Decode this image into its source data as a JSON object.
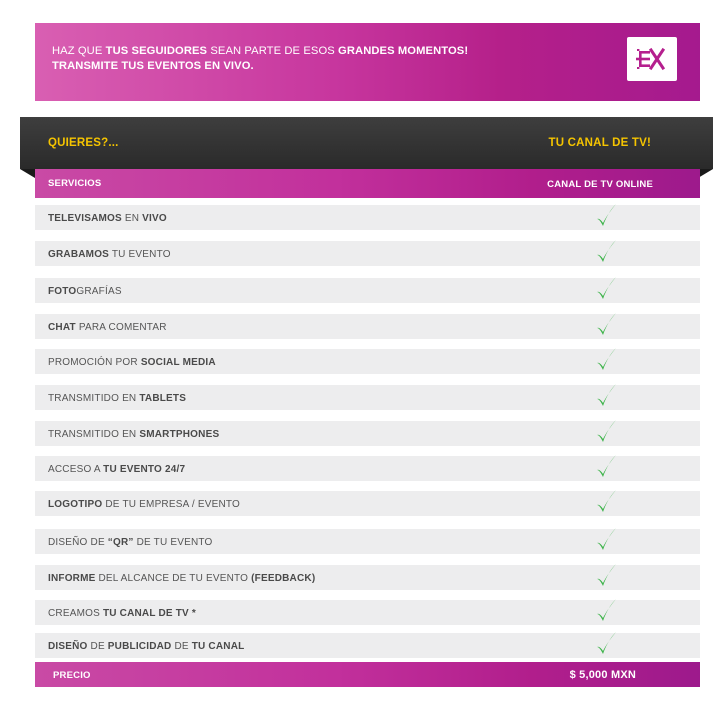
{
  "banner": {
    "line1": [
      {
        "text": "HAZ QUE ",
        "bold": false
      },
      {
        "text": "TUS SEGUIDORES",
        "bold": true
      },
      {
        "text": " SEAN PARTE DE ESOS ",
        "bold": false
      },
      {
        "text": "GRANDES MOMENTOS!",
        "bold": true
      }
    ],
    "line2": [
      {
        "text": "TRANSMITE TUS EVENTOS EN VIVO.",
        "bold": true
      }
    ],
    "logo_icon": "ex-logo-icon"
  },
  "header": {
    "left": "QUIERES?...",
    "right": "TU CANAL DE TV!"
  },
  "services": {
    "label": "SERVICIOS",
    "column": "CANAL DE TV ONLINE"
  },
  "rows": [
    {
      "parts": [
        {
          "t": "TELEVISAMOS",
          "b": true
        },
        {
          "t": " EN ",
          "b": false
        },
        {
          "t": "VIVO",
          "b": true
        }
      ],
      "included": true
    },
    {
      "parts": [
        {
          "t": "GRABAMOS",
          "b": true
        },
        {
          "t": " TU EVENTO",
          "b": false
        }
      ],
      "included": true
    },
    {
      "parts": [
        {
          "t": "FOTO",
          "b": true
        },
        {
          "t": "GRAFÍAS",
          "b": false
        }
      ],
      "included": true
    },
    {
      "parts": [
        {
          "t": "CHAT",
          "b": true
        },
        {
          "t": " PARA COMENTAR",
          "b": false
        }
      ],
      "included": true
    },
    {
      "parts": [
        {
          "t": "PROMOCIÓN POR ",
          "b": false
        },
        {
          "t": "SOCIAL MEDIA",
          "b": true
        }
      ],
      "included": true
    },
    {
      "parts": [
        {
          "t": "TRANSMITIDO EN ",
          "b": false
        },
        {
          "t": "TABLETS",
          "b": true
        }
      ],
      "included": true
    },
    {
      "parts": [
        {
          "t": "TRANSMITIDO EN ",
          "b": false
        },
        {
          "t": "SMARTPHONES",
          "b": true
        }
      ],
      "included": true
    },
    {
      "parts": [
        {
          "t": "ACCESO A ",
          "b": false
        },
        {
          "t": "TU EVENTO 24/7",
          "b": true
        }
      ],
      "included": true
    },
    {
      "parts": [
        {
          "t": "LOGOTIPO",
          "b": true
        },
        {
          "t": " DE TU EMPRESA / EVENTO",
          "b": false
        }
      ],
      "included": true
    },
    {
      "parts": [
        {
          "t": "DISEÑO DE ",
          "b": false
        },
        {
          "t": "“QR”",
          "b": true
        },
        {
          "t": " DE TU EVENTO",
          "b": false
        }
      ],
      "included": true
    },
    {
      "parts": [
        {
          "t": "INFORME",
          "b": true
        },
        {
          "t": " DEL ALCANCE DE TU EVENTO ",
          "b": false
        },
        {
          "t": "(FEEDBACK)",
          "b": true
        }
      ],
      "included": true
    },
    {
      "parts": [
        {
          "t": "CREAMOS ",
          "b": false
        },
        {
          "t": "TU CANAL DE TV",
          "b": true
        },
        {
          "t": "  *",
          "b": true
        }
      ],
      "included": true
    },
    {
      "parts": [
        {
          "t": "DISEÑO",
          "b": true
        },
        {
          "t": " DE ",
          "b": false
        },
        {
          "t": "PUBLICIDAD",
          "b": true
        },
        {
          "t": " DE ",
          "b": false
        },
        {
          "t": "TU CANAL",
          "b": true
        }
      ],
      "included": true
    }
  ],
  "price": {
    "label": "PRECIO",
    "value": "$ 5,000 MXN"
  },
  "colors": {
    "accent_magenta": "#c2309c",
    "header_dark": "#333333",
    "header_text": "#f5c400",
    "check_green": "#3db34a",
    "row_bg": "#ededee"
  },
  "icons": {
    "check": "checkmark-icon"
  }
}
